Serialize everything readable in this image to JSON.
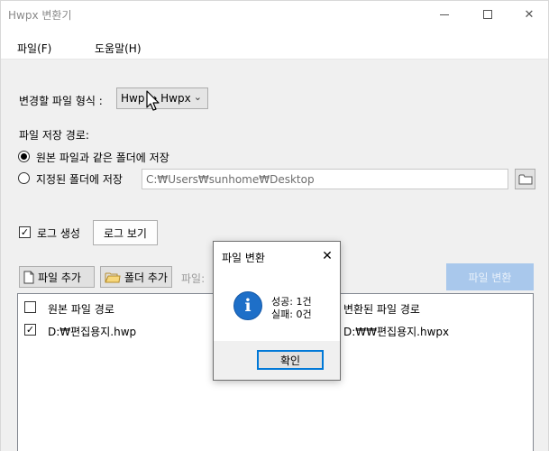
{
  "window": {
    "title": "Hwpx 변환기"
  },
  "menu": {
    "file": "파일(F)",
    "help": "도움말(H)"
  },
  "format": {
    "label": "변경할 파일 형식 :",
    "selected": "Hwp → Hwpx"
  },
  "save": {
    "label": "파일 저장 경로:",
    "option_same": "원본 파일과 같은 폴더에 저장",
    "option_custom": "지정된 폴더에 저장",
    "selected": "same",
    "path": "C:₩Users₩sunhome₩Desktop"
  },
  "log": {
    "checkbox_label": "로그 생성",
    "checked": true,
    "view_button": "로그 보기"
  },
  "toolbar": {
    "add_file": "파일 추가",
    "add_folder": "폴더 추가",
    "file_count_label": "파일:",
    "convert_button": "파일 변환"
  },
  "table": {
    "columns": [
      "원본 파일 경로",
      "변환된 파일 경로"
    ],
    "rows": [
      {
        "checked": true,
        "source": "D:₩편집용지.hwp",
        "target": "D:₩₩편집용지.hwpx"
      }
    ]
  },
  "dialog": {
    "title": "파일 변환",
    "success": "성공: 1건",
    "failure": "실패: 0건",
    "ok_button": "확인"
  },
  "colors": {
    "accent": "#0078d7",
    "info_icon": "#1e6fc8",
    "convert_disabled": "#a9c8ec"
  }
}
